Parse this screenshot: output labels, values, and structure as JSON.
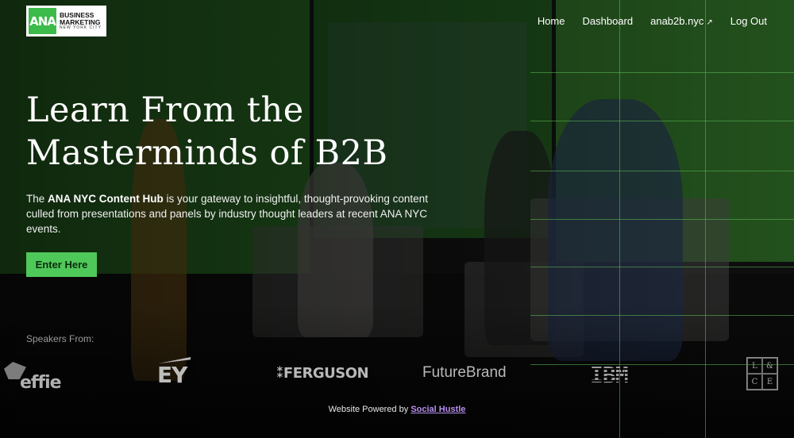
{
  "logo": {
    "mark": "ANA",
    "line1": "BUSINESS",
    "line2": "MARKETING",
    "line3": "NEW YORK CITY"
  },
  "nav": {
    "home": "Home",
    "dashboard": "Dashboard",
    "external": "anab2b.nyc",
    "external_icon": "↗",
    "logout": "Log Out"
  },
  "hero": {
    "title_line1": "Learn From the",
    "title_line2": "Masterminds of B2B",
    "text_before": "The ",
    "text_strong": "ANA NYC Content Hub",
    "text_after": " is your gateway to insightful, thought-provoking content culled from presentations and panels by industry thought leaders at recent ANA NYC events.",
    "cta": "Enter Here"
  },
  "speakers": {
    "label": "Speakers From:",
    "brands": {
      "effie": "effie",
      "ey": "EY",
      "ferguson": "FERGUSON",
      "futurebrand": "FutureBrand",
      "ibm": "IBM",
      "lc": [
        "L",
        "&",
        "C",
        "E"
      ]
    }
  },
  "footer": {
    "powered_text": "Website Powered by ",
    "powered_link": "Social Hustle"
  },
  "colors": {
    "accent_green": "#4fc85a",
    "link_purple": "#b98ef0",
    "grid_green": "#5fbf55"
  }
}
